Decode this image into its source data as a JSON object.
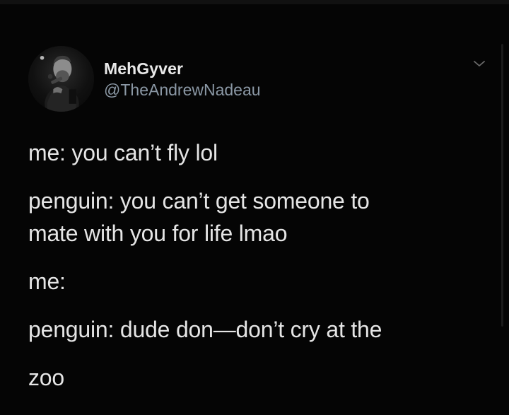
{
  "tweet": {
    "author": {
      "display_name": "MehGyver",
      "handle": "@TheAndrewNadeau",
      "avatar_icon": "profile-photo-microphone-performer"
    },
    "menu_icon": "chevron-down-icon",
    "lines": [
      "me: you can’t fly lol",
      "penguin: you can’t get someone to",
      "mate with you for life lmao",
      "me:",
      "penguin: dude don—don’t cry at the",
      "zoo"
    ]
  },
  "colors": {
    "background": "#050505",
    "text": "#e5e5e5",
    "handle": "#8b98a5",
    "chevron": "#6b6b6b"
  }
}
